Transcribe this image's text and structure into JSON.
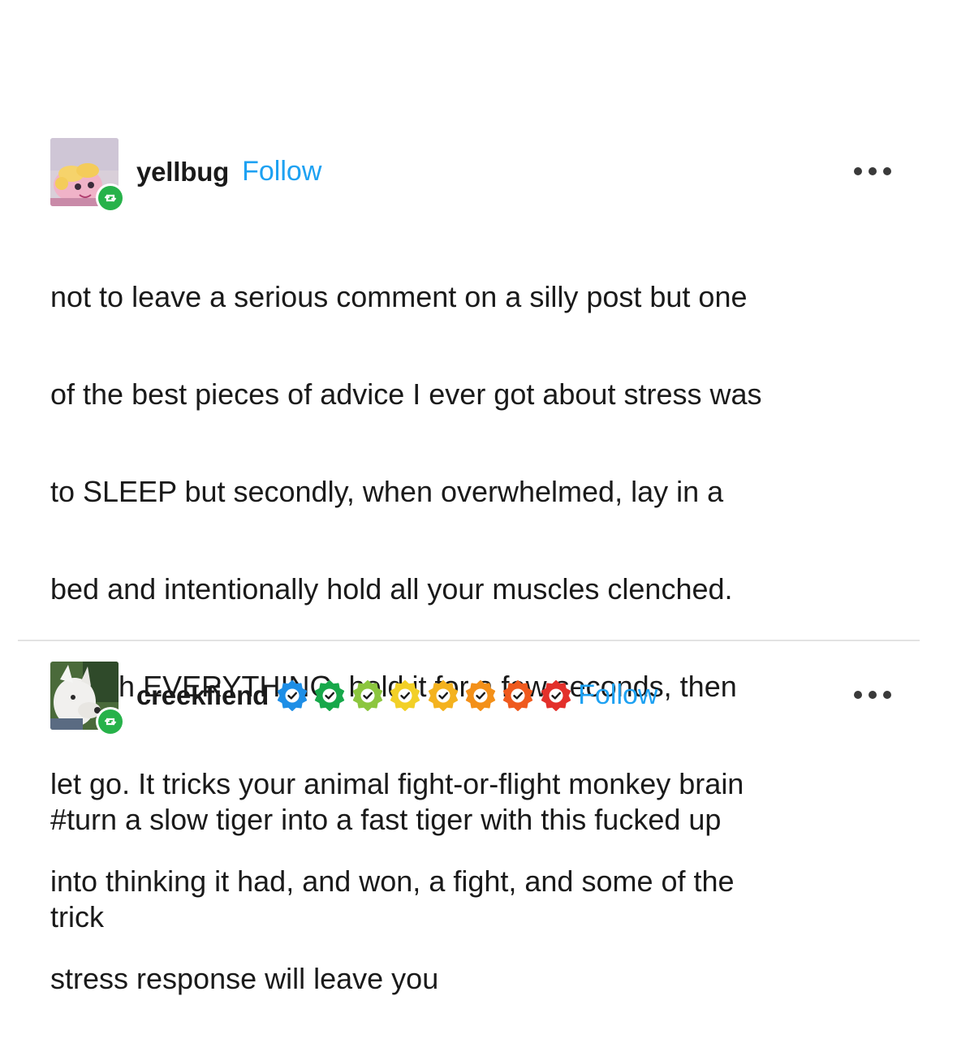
{
  "posts": [
    {
      "username": "yellbug",
      "follow_label": "Follow",
      "body_lines": [
        "not to leave a serious comment on a silly post but one",
        "of the best pieces of advice I ever got about stress was",
        "to SLEEP but secondly, when overwhelmed, lay in a",
        "bed and intentionally hold all your muscles clenched.",
        "clench EVERYTHING. hold it for a few seconds, then",
        "let go. It tricks your animal fight-or-flight monkey brain",
        "into thinking it had, and won, a fight, and some of the",
        "stress response will leave you"
      ],
      "badges": []
    },
    {
      "username": "creekfiend",
      "follow_label": "Follow",
      "body_lines": [
        "#turn a slow tiger into a fast tiger with this fucked up",
        "trick"
      ],
      "badges": [
        "#1e8ee6",
        "#17a84a",
        "#8cc63f",
        "#f2d027",
        "#f4b21f",
        "#f39019",
        "#ef5a1e",
        "#e3302b"
      ]
    }
  ],
  "colors": {
    "follow": "#1da1f2",
    "reblog_badge": "#27b24a",
    "divider": "#e2e2e2"
  },
  "icons": {
    "more": "ellipsis-icon",
    "reblog": "reblog-icon",
    "verified": "checkmark-badge-icon"
  }
}
